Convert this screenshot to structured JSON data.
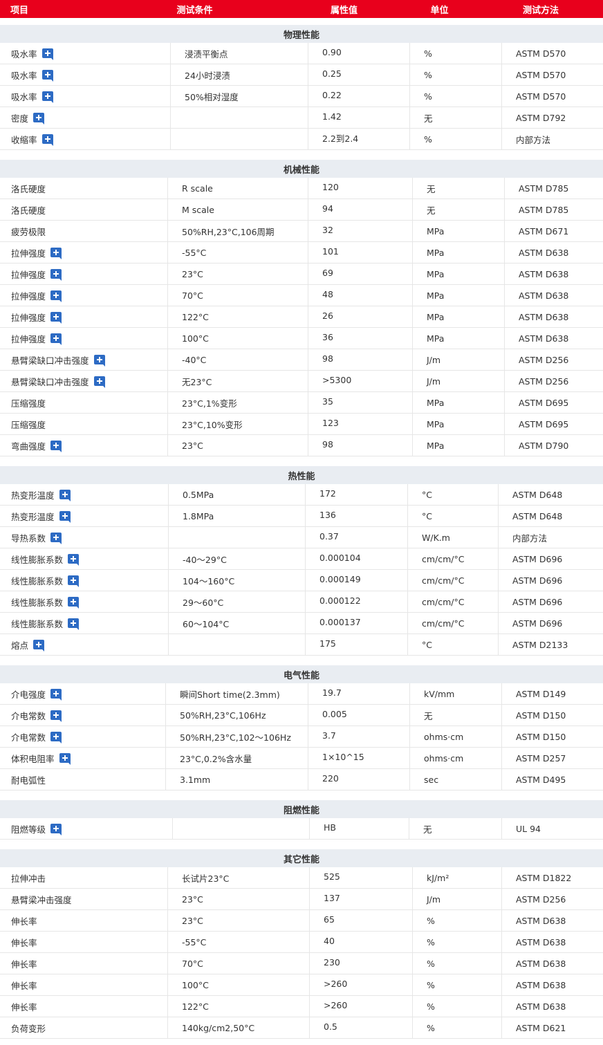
{
  "header": {
    "col_item": "项目",
    "col_condition": "测试条件",
    "col_value": "属性值",
    "col_unit": "单位",
    "col_method": "测试方法"
  },
  "sections": [
    {
      "title": "物理性能",
      "cols": [
        247,
        199,
        147,
        133,
        146
      ],
      "rows": [
        {
          "item": "吸水率",
          "plus": true,
          "cond": "浸渍平衡点",
          "value": "0.90",
          "unit": "%",
          "method": "ASTM D570"
        },
        {
          "item": "吸水率",
          "plus": true,
          "cond": "24小时浸渍",
          "value": "0.25",
          "unit": "%",
          "method": "ASTM D570"
        },
        {
          "item": "吸水率",
          "plus": true,
          "cond": "50%相对湿度",
          "value": "0.22",
          "unit": "%",
          "method": "ASTM D570"
        },
        {
          "item": "密度",
          "plus": true,
          "cond": "",
          "value": "1.42",
          "unit": "无",
          "method": "ASTM D792"
        },
        {
          "item": "收缩率",
          "plus": true,
          "cond": "",
          "value": "2.2到2.4",
          "unit": "%",
          "method": "内部方法"
        }
      ]
    },
    {
      "title": "机械性能",
      "cols": [
        243,
        203,
        151,
        133,
        142
      ],
      "rows": [
        {
          "item": "洛氏硬度",
          "plus": false,
          "cond": "R scale",
          "value": "120",
          "unit": "无",
          "method": "ASTM D785"
        },
        {
          "item": "洛氏硬度",
          "plus": false,
          "cond": "M scale",
          "value": "94",
          "unit": "无",
          "method": "ASTM D785"
        },
        {
          "item": "疲劳极限",
          "plus": false,
          "cond": "50%RH,23°C,106周期",
          "value": "32",
          "unit": "MPa",
          "method": "ASTM D671"
        },
        {
          "item": "拉伸强度",
          "plus": true,
          "cond": "-55°C",
          "value": "101",
          "unit": "MPa",
          "method": "ASTM D638"
        },
        {
          "item": "拉伸强度",
          "plus": true,
          "cond": "23°C",
          "value": "69",
          "unit": "MPa",
          "method": "ASTM D638"
        },
        {
          "item": "拉伸强度",
          "plus": true,
          "cond": "70°C",
          "value": "48",
          "unit": "MPa",
          "method": "ASTM D638"
        },
        {
          "item": "拉伸强度",
          "plus": true,
          "cond": "122°C",
          "value": "26",
          "unit": "MPa",
          "method": "ASTM D638"
        },
        {
          "item": "拉伸强度",
          "plus": true,
          "cond": "100°C",
          "value": "36",
          "unit": "MPa",
          "method": "ASTM D638"
        },
        {
          "item": "悬臂梁缺口冲击强度",
          "plus": true,
          "cond": "-40°C",
          "value": "98",
          "unit": "J/m",
          "method": "ASTM D256"
        },
        {
          "item": "悬臂梁缺口冲击强度",
          "plus": true,
          "cond": "无23°C",
          "value": ">5300",
          "unit": "J/m",
          "method": "ASTM D256"
        },
        {
          "item": "压缩强度",
          "plus": false,
          "cond": "23°C,1%变形",
          "value": "35",
          "unit": "MPa",
          "method": "ASTM D695"
        },
        {
          "item": "压缩强度",
          "plus": false,
          "cond": "23°C,10%变形",
          "value": "123",
          "unit": "MPa",
          "method": "ASTM D695"
        },
        {
          "item": "弯曲强度",
          "plus": true,
          "cond": "23°C",
          "value": "98",
          "unit": "MPa",
          "method": "ASTM D790"
        }
      ]
    },
    {
      "title": "热性能",
      "cols": [
        244,
        198,
        148,
        131,
        151
      ],
      "rows": [
        {
          "item": "热变形温度",
          "plus": true,
          "cond": "0.5MPa",
          "value": "172",
          "unit": "°C",
          "method": "ASTM D648"
        },
        {
          "item": "热变形温度",
          "plus": true,
          "cond": "1.8MPa",
          "value": "136",
          "unit": "°C",
          "method": "ASTM D648"
        },
        {
          "item": "导热系数",
          "plus": true,
          "cond": "",
          "value": "0.37",
          "unit": "W/K.m",
          "method": "内部方法"
        },
        {
          "item": "线性膨胀系数",
          "plus": true,
          "cond": "-40～29°C",
          "value": "0.000104",
          "unit": "cm/cm/°C",
          "method": "ASTM D696"
        },
        {
          "item": "线性膨胀系数",
          "plus": true,
          "cond": "104～160°C",
          "value": "0.000149",
          "unit": "cm/cm/°C",
          "method": "ASTM D696"
        },
        {
          "item": "线性膨胀系数",
          "plus": true,
          "cond": "29～60°C",
          "value": "0.000122",
          "unit": "cm/cm/°C",
          "method": "ASTM D696"
        },
        {
          "item": "线性膨胀系数",
          "plus": true,
          "cond": "60～104°C",
          "value": "0.000137",
          "unit": "cm/cm/°C",
          "method": "ASTM D696"
        },
        {
          "item": "熔点",
          "plus": true,
          "cond": "",
          "value": "175",
          "unit": "°C",
          "method": "ASTM D2133"
        }
      ]
    },
    {
      "title": "电气性能",
      "cols": [
        240,
        206,
        147,
        133,
        146
      ],
      "rows": [
        {
          "item": "介电强度",
          "plus": true,
          "cond": "瞬间Short time(2.3mm)",
          "value": "19.7",
          "unit": "kV/mm",
          "method": "ASTM D149"
        },
        {
          "item": "介电常数",
          "plus": true,
          "cond": "50%RH,23°C,106Hz",
          "value": "0.005",
          "unit": "无",
          "method": "ASTM D150"
        },
        {
          "item": "介电常数",
          "plus": true,
          "cond": "50%RH,23°C,102～106Hz",
          "value": "3.7",
          "unit": "ohms·cm",
          "method": "ASTM D150"
        },
        {
          "item": "体积电阻率",
          "plus": true,
          "cond": "23°C,0.2%含水量",
          "value": "1×10^15",
          "unit": "ohms·cm",
          "method": "ASTM D257"
        },
        {
          "item": "耐电弧性",
          "plus": false,
          "cond": "3.1mm",
          "value": "220",
          "unit": "sec",
          "method": "ASTM D495"
        }
      ]
    },
    {
      "title": "阻燃性能",
      "cols": [
        250,
        198,
        144,
        134,
        146
      ],
      "rows": [
        {
          "item": "阻燃等级",
          "plus": true,
          "cond": "",
          "value": "HB",
          "unit": "无",
          "method": "UL 94"
        }
      ]
    },
    {
      "title": "其它性能",
      "cols": [
        243,
        205,
        149,
        129,
        146
      ],
      "rows": [
        {
          "item": "拉伸冲击",
          "plus": false,
          "cond": "长试片23°C",
          "value": "525",
          "unit": "kJ/m²",
          "method": "ASTM D1822"
        },
        {
          "item": "悬臂梁冲击强度",
          "plus": false,
          "cond": "23°C",
          "value": "137",
          "unit": "J/m",
          "method": "ASTM D256"
        },
        {
          "item": "伸长率",
          "plus": false,
          "cond": "23°C",
          "value": "65",
          "unit": "%",
          "method": "ASTM D638"
        },
        {
          "item": "伸长率",
          "plus": false,
          "cond": "-55°C",
          "value": "40",
          "unit": "%",
          "method": "ASTM D638"
        },
        {
          "item": "伸长率",
          "plus": false,
          "cond": "70°C",
          "value": "230",
          "unit": "%",
          "method": "ASTM D638"
        },
        {
          "item": "伸长率",
          "plus": false,
          "cond": "100°C",
          "value": ">260",
          "unit": "%",
          "method": "ASTM D638"
        },
        {
          "item": "伸长率",
          "plus": false,
          "cond": "122°C",
          "value": ">260",
          "unit": "%",
          "method": "ASTM D638"
        },
        {
          "item": "负荷变形",
          "plus": false,
          "cond": "140kg/cm2,50°C",
          "value": "0.5",
          "unit": "%",
          "method": "ASTM D621"
        }
      ]
    }
  ]
}
